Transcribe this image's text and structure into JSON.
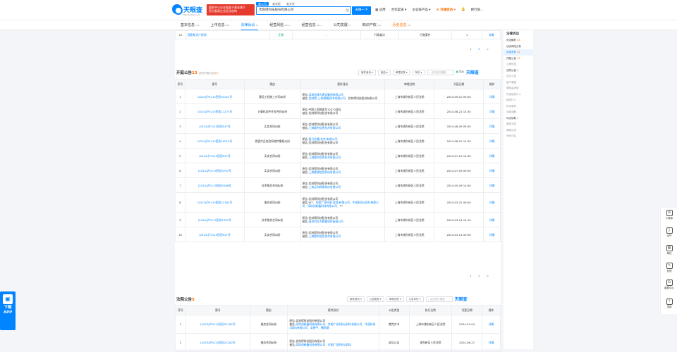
{
  "header": {
    "logo_text": "天眼查",
    "logo_sub": "TianYanCha.com",
    "promo_line1": "国家中小企业发展子基金旗下",
    "promo_line2": "官方备案企业征信机构",
    "search_tabs": [
      "查公司",
      "查老板",
      "查关系"
    ],
    "search_value": "优刻得科技股份有限公司",
    "search_button": "天眼一下",
    "nav": [
      "应用",
      "合作渠道",
      "企业级产品",
      "开通会员",
      "顾行伯..."
    ]
  },
  "subnav": [
    {
      "label": "基本信息",
      "count": "160"
    },
    {
      "label": "上市信息",
      "count": "868"
    },
    {
      "label": "法律诉讼",
      "count": "31"
    },
    {
      "label": "经营风险",
      "count": "999+"
    },
    {
      "label": "经营信息",
      "count": "999+"
    },
    {
      "label": "公司发展",
      "count": "23"
    },
    {
      "label": "知识产权",
      "count": "242"
    },
    {
      "label": "历史信息",
      "count": "167"
    }
  ],
  "top_row": {
    "no": "10",
    "party": "国家知识产权局",
    "status": "正常",
    "dash": "-",
    "type1": "行政裁决",
    "type2": "行政案件",
    "cnt": "1",
    "action": "详情"
  },
  "pager1": [
    "1",
    "2",
    ">"
  ],
  "hearing": {
    "title": "开庭公告",
    "count": "13",
    "sub_pre": "(历史开庭公告",
    "sub_n": "13",
    "sub_post": ")",
    "filters": [
      "案件身份",
      "案由",
      "审理法院",
      "年份"
    ],
    "search_placeholder": "点击进行搜索",
    "export": "导出",
    "watermark": "天眼查",
    "headers": [
      "序号",
      "案号",
      "案由",
      "案件身份",
      "审理法院",
      "开庭日期",
      "操作"
    ],
    "rows": [
      {
        "no": "1",
        "case": "(2024)沪0115民初92222号",
        "reason": "建设工程施工合同纠纷",
        "p1": "原告-",
        "p1l": "深圳创博大建设集团有限公司",
        "p2": "被告-",
        "p2l": "优刻得(上海)数据技术有限公司",
        "p3": "、优刻得科技股份有限公司",
        "court": "上海市浦东新区人民法院",
        "date": "2024-09-10 09:00",
        "act": "详情"
      },
      {
        "no": "2",
        "case": "(2024)沪0115民初11273号",
        "reason": "计算机软件开发合同纠纷",
        "p1": "原告-中国人民解放军32072部队",
        "p1l": "",
        "p2": "被告-",
        "p2l": "",
        "p3": "优刻得科技股份有限公司",
        "court": "上海市浦东新区人民法院",
        "date": "2024-08-22 14:30",
        "act": "详情"
      },
      {
        "no": "3",
        "case": "(2024)沪0115民初547号",
        "reason": "买卖合同纠纷",
        "p1": "原告-优刻得科技股份有限公司",
        "p1l": "",
        "p2": "被告-",
        "p2l": "上海晨杰信息技术有限公司",
        "p3": "",
        "court": "上海市浦东新区人民法院",
        "date": "2024-08-09 09:30",
        "act": "详情"
      },
      {
        "no": "4",
        "case": "(2024)沪0115民初16519号",
        "reason": "侵害作品信息网络传播权纠纷",
        "p1": "原告-",
        "p1l": "喜马拉雅(北京)有限公司",
        "p2": "被告-优刻得科技股份有限公司",
        "p2l": "",
        "p3": "",
        "court": "上海市浦东新区人民法院",
        "date": "2024-08-01 14:30",
        "act": "详情"
      },
      {
        "no": "5",
        "case": "(2024)沪0115民初547号",
        "reason": "买卖合同纠纷",
        "p1": "原告-优刻得科技股份有限公司",
        "p1l": "",
        "p2": "被告-",
        "p2l": "上海晨杰信息技术有限公司",
        "p3": "",
        "court": "上海市浦东新区人民法院",
        "date": "2024-07-12 14:30",
        "act": "详情"
      },
      {
        "no": "6",
        "case": "(2024)沪0115民初4791号",
        "reason": "买卖合同纠纷",
        "p1": "原告-优刻得科技股份有限公司",
        "p1l": "",
        "p2": "被告-",
        "p2l": "上海晨骐信息科技有限公司",
        "p3": "",
        "court": "上海市浦东新区人民法院",
        "date": "2024-07-09 09:30",
        "act": "详情"
      },
      {
        "no": "7",
        "case": "(2024)沪0115民初4186号",
        "reason": "技术服务合同纠纷",
        "p1": "原告-优刻得科技股份有限公司",
        "p1l": "",
        "p2": "被告-",
        "p2l": "上海云尚网络科技有限公司",
        "p3": "",
        "court": "上海市浦东新区人民法院",
        "date": "2024-05-09 14:00",
        "act": "详情"
      },
      {
        "no": "8",
        "case": "(2023)沪0115民初22162号",
        "reason": "服务合同纠纷",
        "p1": "原告-优刻得科技股份有限公司",
        "p1l": "",
        "p2": "被告-WT、",
        "p2l": "京阁广深科技(深圳)有限公司、牛昌科技(深圳)有限公司、深圳创新鑫科技有限公司、",
        "p3": "T*",
        "court": "上海市浦东新区人民法院",
        "date": "2024-03-22 09:00",
        "act": "详情"
      },
      {
        "no": "9",
        "case": "(2024)沪0115民初1303号",
        "reason": "技术服务合同纠纷",
        "p1": "原告-优刻得科技股份有限公司",
        "p1l": "",
        "p2": "被告-",
        "p2l": "青岛利东大数据科技有限公司",
        "p3": "",
        "court": "上海市浦东新区人民法院",
        "date": "2024-03-14 14:10",
        "act": "详情"
      },
      {
        "no": "10",
        "case": "(2024)沪0115民初547号",
        "reason": "买卖合同纠纷",
        "p1": "原告-优刻得科技股份有限公司",
        "p1l": "",
        "p2": "被告-",
        "p2l": "上海晨杰信息技术有限公司",
        "p3": "",
        "court": "上海市浦东新区人民法院",
        "date": "2024-03-14 09:30",
        "act": "详情"
      }
    ]
  },
  "pager2": [
    "1",
    "2",
    ">"
  ],
  "court": {
    "title": "法院公告",
    "count": "5",
    "filters": [
      "案件身份",
      "公告类型",
      "审理法院",
      "公告年份"
    ],
    "search_placeholder": "点击进行搜索",
    "watermark": "天眼查",
    "headers": [
      "序号",
      "案号",
      "案由",
      "案件身份",
      "公告类型",
      "执行法院",
      "刊登日期",
      "操作"
    ],
    "rows": [
      {
        "no": "1",
        "case": "(2023)沪0115民初22162号",
        "reason": "服务合同纠纷",
        "p1": "原告-优刻得科技股份有限公司",
        "p2": "被告-",
        "p2l": "深圳创新鑫科技有限公司、京阁广深科技(深圳)有限公司、牛昌科技(深圳)有限公司、吴晓宇、魏思健",
        "type": "裁判文书",
        "court": "上海市浦东新区人民法院",
        "date": "2024-07-04",
        "act": "详情"
      },
      {
        "no": "2",
        "case": "(2023)沪0115民初22162号",
        "reason": "服务合同纠纷",
        "p1": "原告-优刻得科技股份有限公司",
        "p2": "被告-",
        "p2l": "深圳创新鑫科技有限公司、京阁广深科技(深圳)",
        "type": "诉讼公告",
        "court": "浦东新区人民法院",
        "date": "2024-06-27",
        "act": "详情"
      }
    ]
  },
  "right_nav": {
    "title": "法律诉讼",
    "items": [
      {
        "label": "司法解析",
        "n": "43",
        "state": "on"
      },
      {
        "label": "涉诉风险分析",
        "n": "",
        "state": "on"
      },
      {
        "label": "涉诉关系",
        "n": "12",
        "state": "sel"
      },
      {
        "label": "开庭公告",
        "n": "13",
        "state": "on"
      },
      {
        "label": "立案信息",
        "n": "",
        "state": "off"
      },
      {
        "label": "法院公告",
        "n": "5",
        "state": "on"
      },
      {
        "label": "送达公告",
        "n": "",
        "state": "off"
      },
      {
        "label": "破产重整",
        "n": "",
        "state": "off"
      },
      {
        "label": "限制高消费",
        "n": "",
        "state": "off"
      },
      {
        "label": "失信被执行人",
        "n": "",
        "state": "off"
      },
      {
        "label": "被执行人",
        "n": "",
        "state": "off"
      },
      {
        "label": "终本案件",
        "n": "",
        "state": "off"
      },
      {
        "label": "诉前调解",
        "n": "",
        "state": "off"
      },
      {
        "label": "司法协助",
        "n": "2",
        "state": "on"
      },
      {
        "label": "股权冻结",
        "n": "",
        "state": "off"
      },
      {
        "label": "限制出境",
        "n": "",
        "state": "off"
      },
      {
        "label": "询价评估",
        "n": "",
        "state": "off"
      }
    ]
  },
  "floatbar": [
    "小程序",
    "APP",
    "单位",
    "反馈",
    "客服中心",
    "顶部"
  ],
  "app_float": {
    "qr": "▣",
    "line1": "下载",
    "line2": "APP"
  }
}
